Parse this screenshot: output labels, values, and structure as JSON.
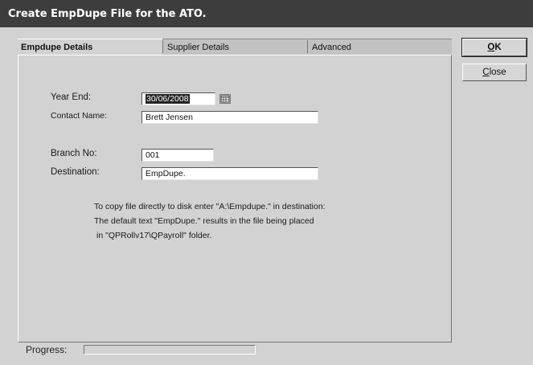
{
  "window": {
    "title": "Create EmpDupe File for the ATO."
  },
  "tabs": [
    {
      "label": "Empdupe Details",
      "active": true
    },
    {
      "label": "Supplier Details",
      "active": false
    },
    {
      "label": "Advanced",
      "active": false
    }
  ],
  "form": {
    "year_end": {
      "label": "Year End:",
      "value": "30/06/2008"
    },
    "contact_name": {
      "label": "Contact Name:",
      "value": "Brett Jensen"
    },
    "branch_no": {
      "label": "Branch No:",
      "value": "001"
    },
    "destination": {
      "label": "Destination:",
      "value": "EmpDupe."
    }
  },
  "info_lines": [
    "To copy file directly to disk enter \"A:\\Empdupe.\" in destination:",
    "The default text \"EmpDupe.\" results in the file being placed",
    "in \"QPRollv17\\QPayroll\" folder."
  ],
  "buttons": {
    "ok": {
      "label_first": "O",
      "label_rest": "K"
    },
    "close": {
      "label_first": "C",
      "label_rest": "lose"
    }
  },
  "progress": {
    "label": "Progress:",
    "fraction": 0
  },
  "icons": {
    "calendar": "calendar-icon"
  }
}
